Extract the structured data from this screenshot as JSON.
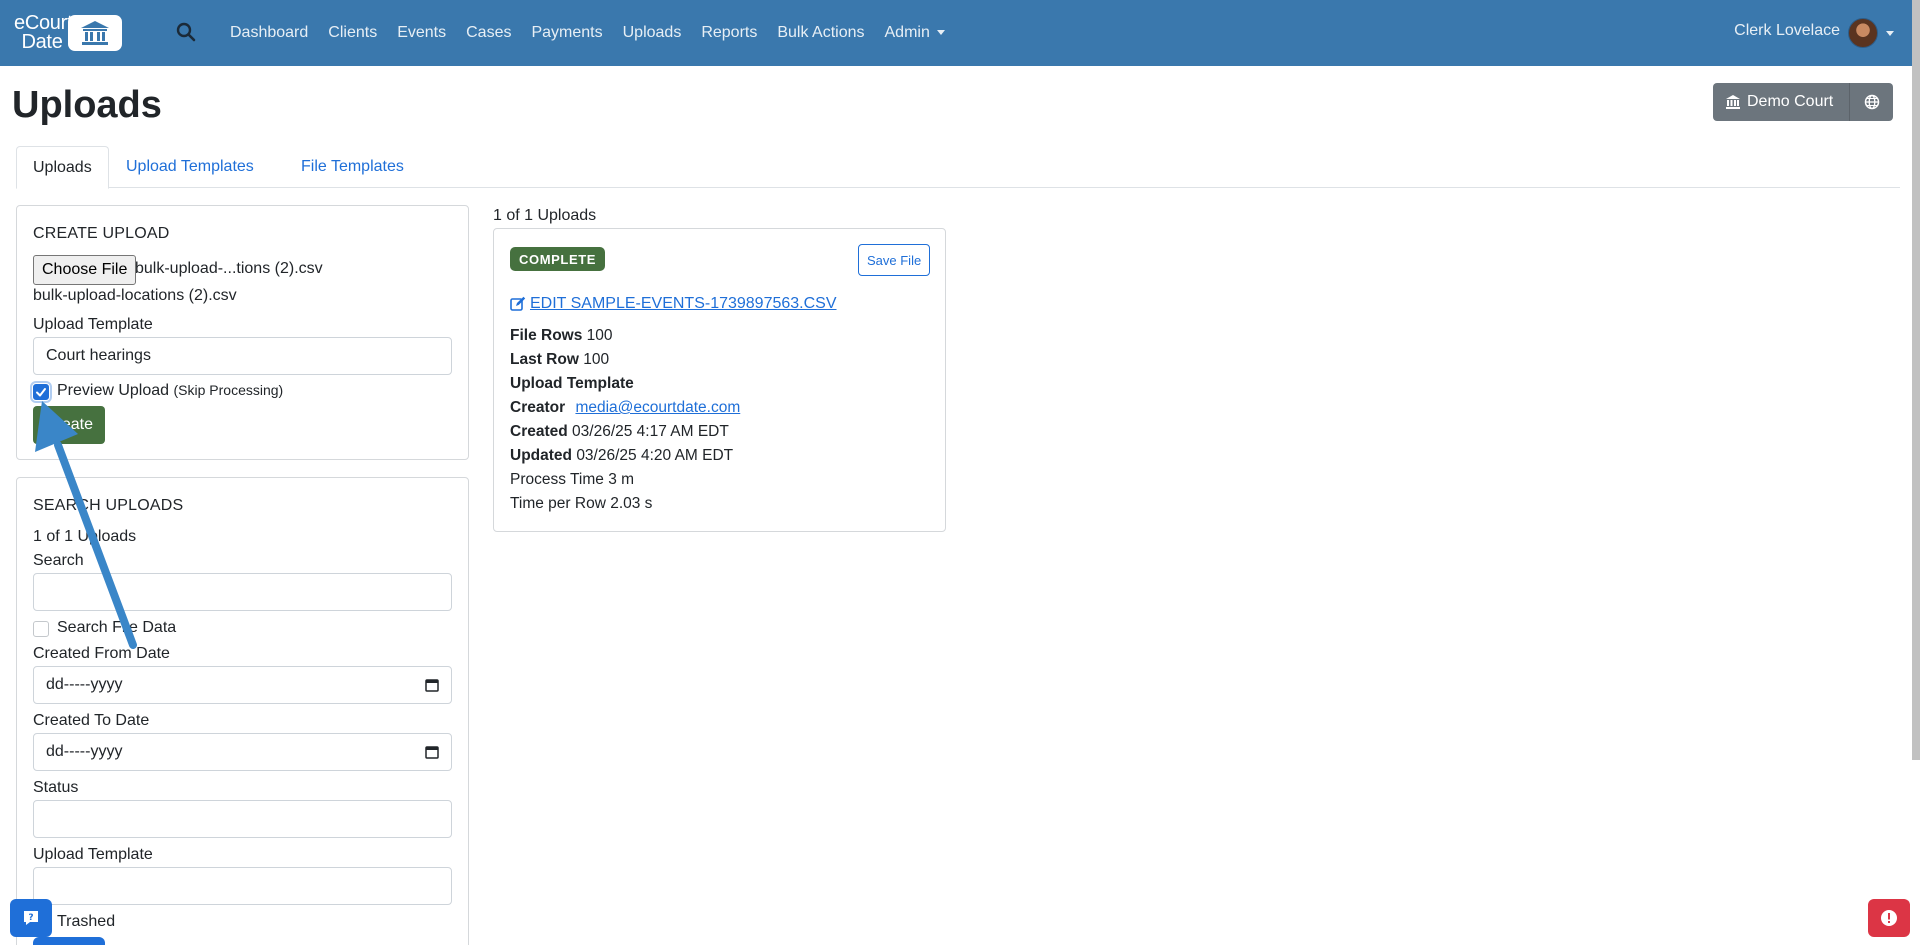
{
  "navbar": {
    "logo_line1": "eCourt",
    "logo_line2": "Date",
    "links": [
      "Dashboard",
      "Clients",
      "Events",
      "Cases",
      "Payments",
      "Uploads",
      "Reports",
      "Bulk Actions"
    ],
    "admin_label": "Admin",
    "user_name": "Clerk Lovelace"
  },
  "page": {
    "title": "Uploads",
    "court_button": "Demo Court"
  },
  "tabs": [
    "Uploads",
    "Upload Templates",
    "File Templates"
  ],
  "create_upload": {
    "title": "CREATE UPLOAD",
    "choose_file_label": "Choose File",
    "file_name_short": "bulk-upload-...tions (2).csv",
    "file_name_full": "bulk-upload-locations (2).csv",
    "template_label": "Upload Template",
    "template_value": "Court hearings",
    "preview_label": "Preview Upload",
    "preview_note": "(Skip Processing)",
    "preview_checked": true,
    "create_button": "Create"
  },
  "search_uploads": {
    "title": "SEARCH UPLOADS",
    "count": "1 of 1 Uploads",
    "search_label": "Search",
    "search_file_data_label": "Search File Data",
    "from_label": "Created From Date",
    "from_placeholder": "dd-----yyyy",
    "to_label": "Created To Date",
    "to_placeholder": "dd-----yyyy",
    "status_label": "Status",
    "template_label": "Upload Template",
    "trashed_label": "Trashed"
  },
  "results": {
    "count": "1 of 1 Uploads",
    "status_badge": "COMPLETE",
    "save_button": "Save File",
    "edit_link": "EDIT SAMPLE-EVENTS-1739897563.CSV",
    "file_rows_label": "File Rows",
    "file_rows_value": "100",
    "last_row_label": "Last Row",
    "last_row_value": "100",
    "upload_template_label": "Upload Template",
    "creator_label": "Creator",
    "creator_email": "media@ecourtdate.com",
    "created_label": "Created",
    "created_value": "03/26/25 4:17 AM EDT",
    "updated_label": "Updated",
    "updated_value": "03/26/25 4:20 AM EDT",
    "process_time": "Process Time 3 m",
    "time_per_row": "Time per Row 2.03 s"
  },
  "colors": {
    "navbar": "#3a78ad",
    "primary": "#1f6fd8",
    "success": "#46713f",
    "secondary": "#6c757d",
    "danger": "#dc3545",
    "annotation_arrow": "#3a86c8"
  },
  "icons": {
    "logo": "courthouse-icon",
    "search": "search-icon",
    "court": "courthouse-icon",
    "globe": "globe-icon",
    "edit": "edit-icon",
    "calendar": "calendar-icon",
    "chat": "chat-icon",
    "alert": "alert-icon"
  }
}
